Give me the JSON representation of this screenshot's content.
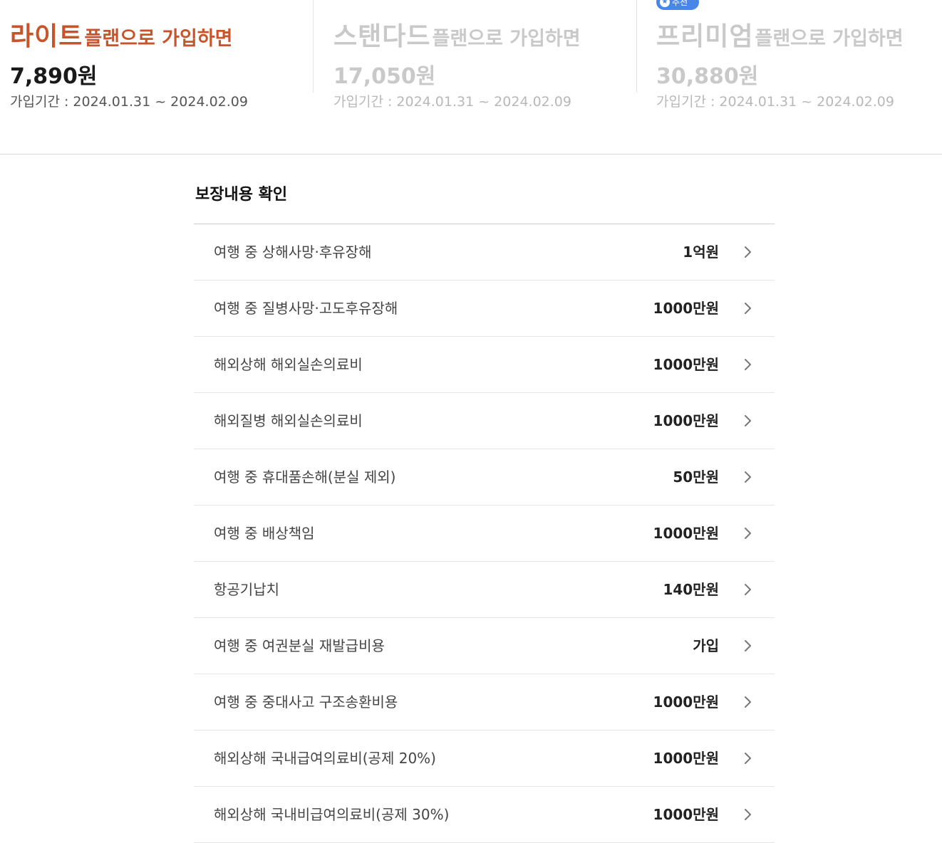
{
  "plans": [
    {
      "name": "라이트",
      "suffix": "플랜으로 가입하면",
      "price": "7,890원",
      "period": "가입기간 : 2024.01.31 ~ 2024.02.09",
      "selected": true
    },
    {
      "name": "스탠다드",
      "suffix": "플랜으로 가입하면",
      "price": "17,050원",
      "period": "가입기간 : 2024.01.31 ~ 2024.02.09",
      "selected": false
    },
    {
      "name": "프리미엄",
      "suffix": "플랜으로 가입하면",
      "price": "30,880원",
      "period": "가입기간 : 2024.01.31 ~ 2024.02.09",
      "selected": false,
      "badge": "추천"
    }
  ],
  "colors": {
    "accent": "#c8542b",
    "badge": "#4a86e8",
    "inactive": "#c9c9c9"
  },
  "coverage": {
    "title": "보장내용 확인",
    "items": [
      {
        "label": "여행 중 상해사망·후유장해",
        "value": "1억원"
      },
      {
        "label": "여행 중 질병사망·고도후유장해",
        "value": "1000만원"
      },
      {
        "label": "해외상해 해외실손의료비",
        "value": "1000만원"
      },
      {
        "label": "해외질병 해외실손의료비",
        "value": "1000만원"
      },
      {
        "label": "여행 중 휴대품손해(분실 제외)",
        "value": "50만원"
      },
      {
        "label": "여행 중 배상책임",
        "value": "1000만원"
      },
      {
        "label": "항공기납치",
        "value": "140만원"
      },
      {
        "label": "여행 중 여권분실 재발급비용",
        "value": "가입"
      },
      {
        "label": "여행 중 중대사고 구조송환비용",
        "value": "1000만원"
      },
      {
        "label": "해외상해 국내급여의료비(공제 20%)",
        "value": "1000만원"
      },
      {
        "label": "해외상해 국내비급여의료비(공제 30%)",
        "value": "1000만원"
      }
    ]
  }
}
